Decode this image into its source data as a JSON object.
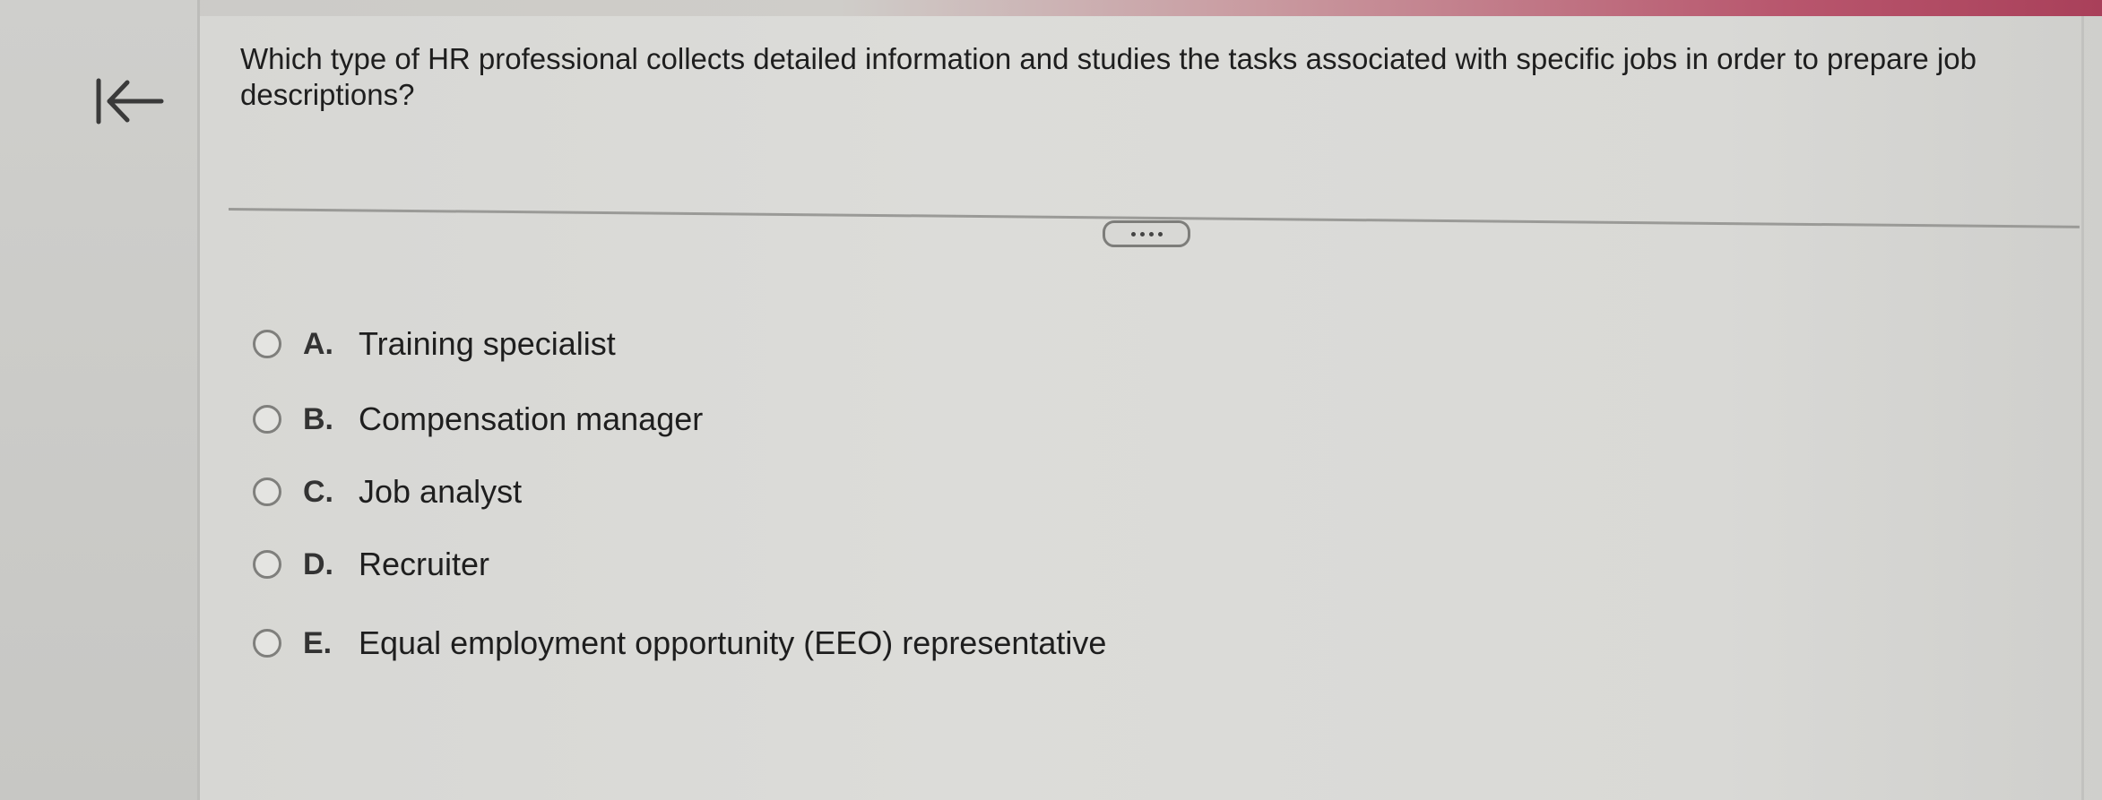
{
  "question": {
    "text": "Which type of HR professional collects detailed information and studies the tasks associated with specific jobs in order to prepare job descriptions?"
  },
  "navigation": {
    "back_icon": "first-page-arrow-icon"
  },
  "more_button": {
    "icon": "ellipsis-icon"
  },
  "options": [
    {
      "letter": "A.",
      "text": "Training specialist"
    },
    {
      "letter": "B.",
      "text": "Compensation manager"
    },
    {
      "letter": "C.",
      "text": "Job analyst"
    },
    {
      "letter": "D.",
      "text": "Recruiter"
    },
    {
      "letter": "E.",
      "text": "Equal employment opportunity (EEO) representative"
    }
  ],
  "colors": {
    "top_band_accent": "#b8566d",
    "radio_border": "#7f7f7c",
    "text": "#1e1e1e"
  }
}
